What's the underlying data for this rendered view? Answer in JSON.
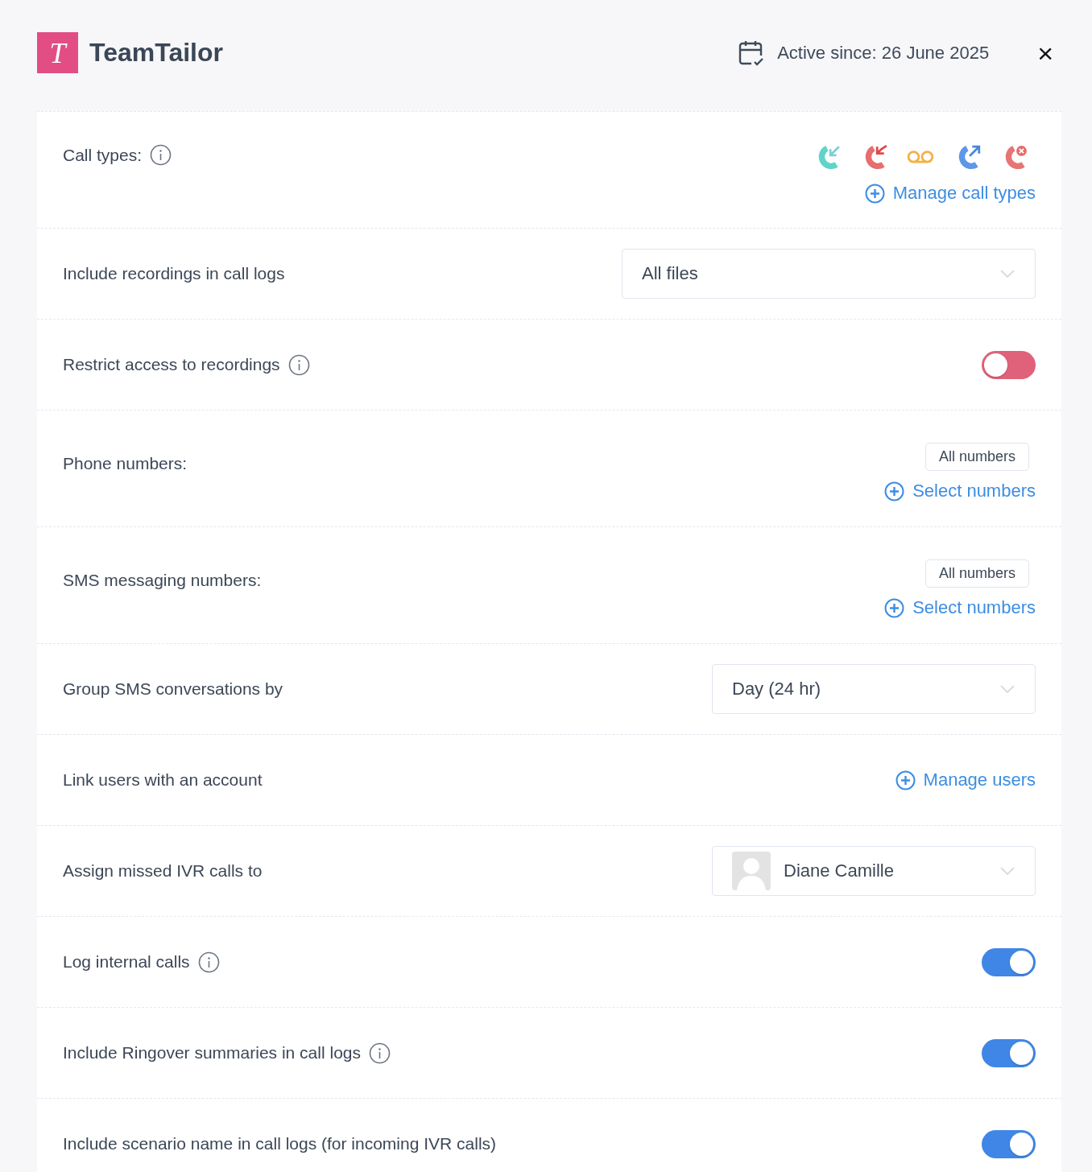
{
  "header": {
    "logo_letter": "T",
    "title": "TeamTailor",
    "active_since": "Active since: 26 June 2025",
    "close": "×"
  },
  "rows": [
    {
      "kind": "call_types",
      "label": "Call types:",
      "info": true,
      "icons": [
        {
          "kind": "incoming"
        },
        {
          "kind": "missed"
        },
        {
          "kind": "voicemail"
        },
        {
          "kind": "outgoing"
        },
        {
          "kind": "failed"
        }
      ],
      "link": "Manage call types"
    },
    {
      "kind": "select",
      "label": "Include recordings in call logs",
      "info": false,
      "value": "All files"
    },
    {
      "kind": "toggle",
      "label": "Restrict access to recordings",
      "info": true,
      "on": false
    },
    {
      "kind": "numbers",
      "label": "Phone numbers:",
      "info": false,
      "chip": "All numbers",
      "link": "Select numbers"
    },
    {
      "kind": "numbers",
      "label": "SMS messaging numbers:",
      "info": false,
      "chip": "All numbers",
      "link": "Select numbers"
    },
    {
      "kind": "select",
      "label": "Group SMS conversations by",
      "info": false,
      "value": "Day (24 hr)"
    },
    {
      "kind": "link",
      "label": "Link users with an account",
      "info": false,
      "link": "Manage users"
    },
    {
      "kind": "user_select",
      "label": "Assign missed IVR calls to",
      "info": false,
      "value": "Diane Camille"
    },
    {
      "kind": "toggle",
      "label": "Log internal calls",
      "info": true,
      "on": true
    },
    {
      "kind": "toggle",
      "label": "Include Ringover summaries in call logs",
      "info": true,
      "on": true
    },
    {
      "kind": "toggle",
      "label": "Include scenario name in call logs (for incoming IVR calls)",
      "info": false,
      "on": true
    }
  ]
}
